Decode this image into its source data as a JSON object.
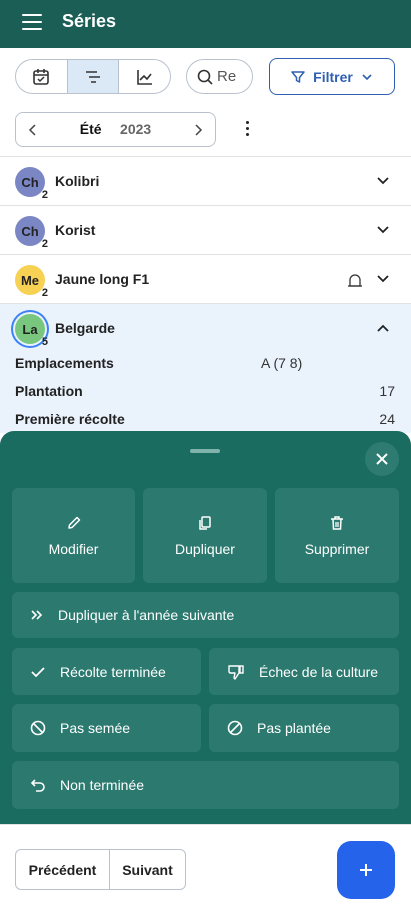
{
  "appbar": {
    "title": "Séries",
    "menu_icon": "hamburger-icon"
  },
  "view_toggle": {
    "items": [
      {
        "icon": "calendar-icon"
      },
      {
        "icon": "list-sort-icon",
        "active": true
      },
      {
        "icon": "chart-icon"
      }
    ]
  },
  "search": {
    "placeholder": "Re",
    "icon": "search-icon"
  },
  "filter": {
    "label": "Filtrer",
    "icon": "filter-icon"
  },
  "season": {
    "label": "Été",
    "year": "2023"
  },
  "series": [
    {
      "initials": "Ch",
      "count": "2",
      "name": "Kolibri",
      "color": "#7b86c4"
    },
    {
      "initials": "Ch",
      "count": "2",
      "name": "Korist",
      "color": "#7b86c4"
    },
    {
      "initials": "Me",
      "count": "2",
      "name": "Jaune long F1",
      "color": "#f7d154",
      "bell": true
    },
    {
      "initials": "La",
      "count": "5",
      "name": "Belgarde",
      "color": "#79c77f",
      "expanded": true
    }
  ],
  "details": [
    {
      "label": "Emplacements",
      "value": "A (7 8)"
    },
    {
      "label": "Plantation",
      "value": "17"
    },
    {
      "label": "Première récolte",
      "value": "24"
    }
  ],
  "sheet": {
    "top_actions": [
      {
        "label": "Modifier",
        "icon": "pencil-icon"
      },
      {
        "label": "Dupliquer",
        "icon": "copy-icon"
      },
      {
        "label": "Supprimer",
        "icon": "trash-icon"
      }
    ],
    "duplicate_next": {
      "label": "Dupliquer à l'année suivante",
      "icon": "double-chevron-icon"
    },
    "grid_actions": [
      {
        "label": "Récolte terminée",
        "icon": "check-icon"
      },
      {
        "label": "Échec de la culture",
        "icon": "thumbs-down-icon"
      },
      {
        "label": "Pas semée",
        "icon": "ban-icon"
      },
      {
        "label": "Pas plantée",
        "icon": "slash-circle-icon"
      }
    ],
    "undo": {
      "label": "Non terminée",
      "icon": "undo-icon"
    }
  },
  "pager": {
    "prev": "Précédent",
    "next": "Suivant"
  },
  "fab": {
    "label": "+"
  },
  "colors": {
    "appbar": "#1b5e55",
    "sheet": "#1a6b60",
    "accent": "#2563eb",
    "filter": "#2f5fb3"
  }
}
